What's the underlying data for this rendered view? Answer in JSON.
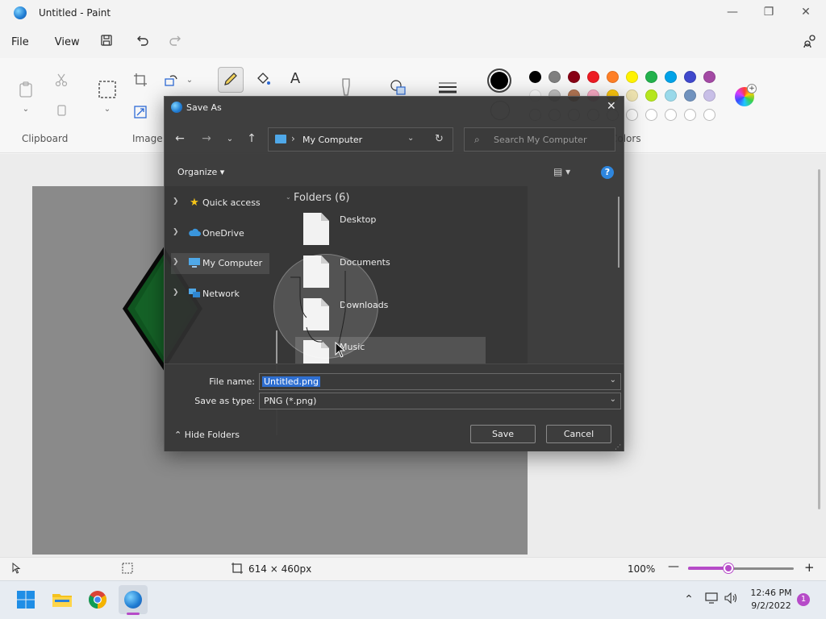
{
  "window": {
    "title": "Untitled - Paint",
    "minimize_glyph": "—",
    "maximize_glyph": "❐",
    "close_glyph": "✕"
  },
  "menu": {
    "file": "File",
    "view": "View"
  },
  "ribbon": {
    "groups": {
      "clipboard": "Clipboard",
      "image": "Image",
      "colors": "Colors"
    },
    "palette_row1": [
      "#000000",
      "#7f7f7f",
      "#880015",
      "#ed1c24",
      "#ff7f27",
      "#fff200",
      "#22b14c",
      "#00a2e8",
      "#3f48cc",
      "#a349a4"
    ],
    "palette_row2": [
      "#ffffff",
      "#c3c3c3",
      "#b97a57",
      "#ffaec9",
      "#ffc90e",
      "#efe4b0",
      "#b5e61d",
      "#99d9ea",
      "#7092be",
      "#c8bfe7"
    ],
    "primary_color": "#000000",
    "secondary_color": "#ffffff"
  },
  "dialog": {
    "title": "Save As",
    "address": "My Computer",
    "search_placeholder": "Search My Computer",
    "organize_label": "Organize ▾",
    "help_glyph": "?",
    "nav_items": [
      {
        "label": "Quick access",
        "icon": "star-icon"
      },
      {
        "label": "OneDrive",
        "icon": "cloud-icon"
      },
      {
        "label": "My Computer",
        "icon": "computer-icon"
      },
      {
        "label": "Network",
        "icon": "network-icon"
      }
    ],
    "folders_header": "Folders (6)",
    "folders": [
      "Desktop",
      "Documents",
      "Downloads",
      "Music"
    ],
    "file_name_label": "File name:",
    "file_name_value": "Untitled.png",
    "save_as_type_label": "Save as type:",
    "save_as_type_value": "PNG (*.png)",
    "hide_folders": "Hide Folders",
    "save_button": "Save",
    "cancel_button": "Cancel"
  },
  "status": {
    "canvas_size": "614 × 460px",
    "zoom": "100%",
    "zoom_level_percent": 38
  },
  "taskbar": {
    "time": "12:46 PM",
    "date": "9/2/2022",
    "notification_count": "1"
  },
  "colors": {
    "accent": "#b64bc8",
    "shape_fill": "#1f9e3b"
  }
}
